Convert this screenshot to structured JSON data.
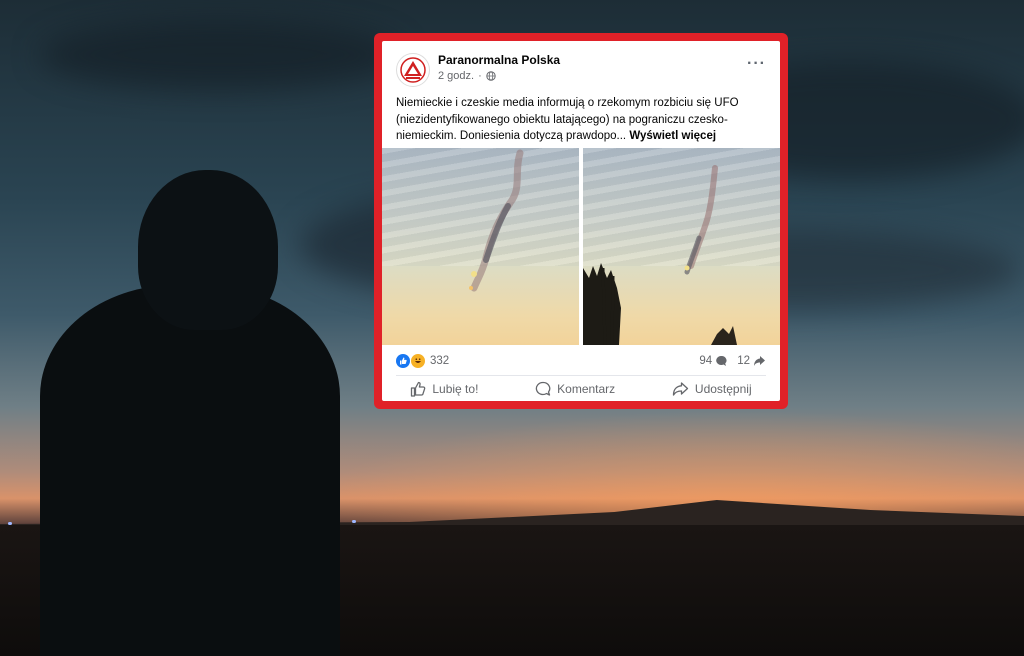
{
  "post": {
    "page_name": "Paranormalna Polska",
    "time": "2 godz.",
    "audience_icon": "globe-icon",
    "more_label": "···",
    "text": "Niemieckie i czeskie media informują o rzekomym rozbiciu się UFO (niezidentyfikowanego obiektu latającego) na pograniczu czesko-niemieckim. Doniesienia dotyczą prawdopo...",
    "see_more": "Wyświetl więcej",
    "reactions_count": "332",
    "comments_count": "94",
    "shares_count": "12"
  },
  "actions": {
    "like": "Lubię to!",
    "comment": "Komentarz",
    "share": "Udostępnij"
  },
  "colors": {
    "frame_red": "#e02128",
    "like_blue": "#1877f2",
    "haha_yellow": "#f7b125"
  }
}
